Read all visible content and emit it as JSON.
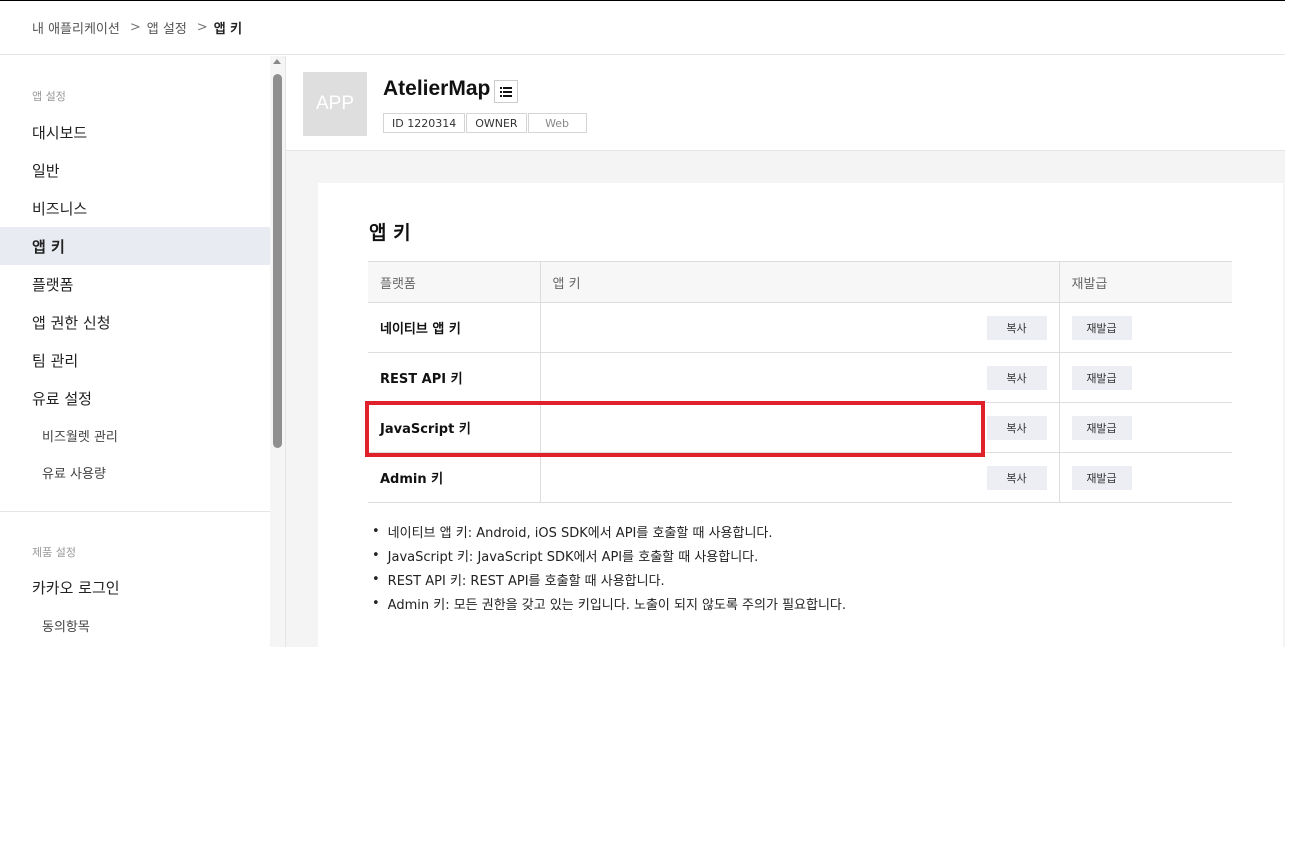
{
  "breadcrumb": {
    "item1": "내 애플리케이션",
    "item2": "앱 설정",
    "current": "앱 키",
    "separator": ">"
  },
  "sidebar": {
    "section_app": "앱 설정",
    "items": [
      {
        "label": "대시보드"
      },
      {
        "label": "일반"
      },
      {
        "label": "비즈니스"
      },
      {
        "label": "앱 키",
        "active": true
      },
      {
        "label": "플랫폼"
      },
      {
        "label": "앱 권한 신청"
      },
      {
        "label": "팀 관리"
      },
      {
        "label": "유료 설정"
      }
    ],
    "sub_items": [
      {
        "label": "비즈월렛 관리"
      },
      {
        "label": "유료 사용량"
      }
    ],
    "section_product": "제품 설정",
    "product_items": [
      {
        "label": "카카오 로그인"
      }
    ],
    "product_sub_items": [
      {
        "label": "동의항목"
      }
    ]
  },
  "app": {
    "thumb_text": "APP",
    "name": "AtelierMap",
    "id_badge": "ID 1220314",
    "role_badge": "OWNER",
    "platform_badge": "Web"
  },
  "panel": {
    "title": "앱 키",
    "headers": {
      "platform": "플랫폼",
      "app_key": "앱 키",
      "reissue": "재발급"
    },
    "rows": [
      {
        "name": "네이티브 앱 키",
        "copy": "복사",
        "reissue": "재발급"
      },
      {
        "name": "REST API 키",
        "copy": "복사",
        "reissue": "재발급"
      },
      {
        "name": "JavaScript 키",
        "copy": "복사",
        "reissue": "재발급"
      },
      {
        "name": "Admin 키",
        "copy": "복사",
        "reissue": "재발급"
      }
    ],
    "notes": [
      "네이티브 앱 키: Android, iOS SDK에서 API를 호출할 때 사용합니다.",
      "JavaScript 키: JavaScript SDK에서 API를 호출할 때 사용합니다.",
      "REST API 키: REST API를 호출할 때 사용합니다.",
      "Admin 키: 모든 권한을 갖고 있는 키입니다. 노출이 되지 않도록 주의가 필요합니다."
    ]
  },
  "colors": {
    "highlight": "#e0202a",
    "active_nav_bg": "#e9ebf2",
    "button_bg": "#eceef4"
  },
  "icons": {
    "list": "list-icon",
    "scroll_up": "scroll-up-arrow"
  }
}
